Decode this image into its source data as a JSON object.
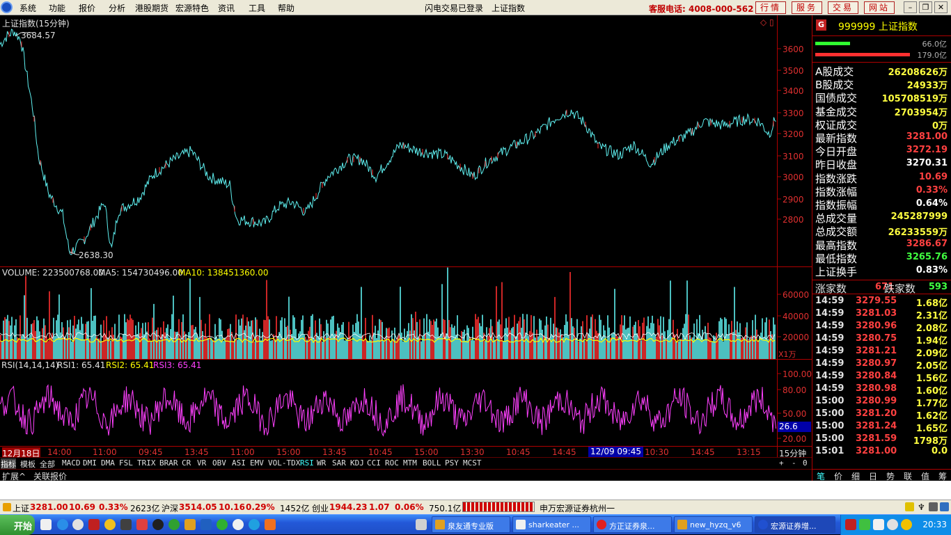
{
  "menu": {
    "items": [
      "系统",
      "功能",
      "报价",
      "分析",
      "港股期货",
      "宏源特色",
      "资讯",
      "工具",
      "帮助"
    ],
    "status_center": "闪电交易已登录",
    "center_title": "上证指数",
    "hotline": "客服电话: 4008-000-562",
    "tabs": [
      "行情",
      "服务",
      "交易",
      "网站"
    ]
  },
  "chart": {
    "title": "上证指数(15分钟)",
    "high_label": "3684.57",
    "low_label": "2638.30",
    "price_ticks": [
      "3600",
      "3500",
      "3400",
      "3300",
      "3200",
      "3100",
      "3000",
      "2900",
      "2800"
    ],
    "volume_header": {
      "vol": "VOLUME: 223500768.00",
      "ma5": "MA5: 154730496.00",
      "ma10": "MA10: 138451360.00"
    },
    "volume_ticks": [
      "60000",
      "40000",
      "20000"
    ],
    "volume_unit": "X1万",
    "rsi_header": {
      "name": "RSI(14,14,14)",
      "rsi1": "RSI1: 65.41",
      "rsi2": "RSI2: 65.41",
      "rsi3": "RSI3: 65.41"
    },
    "rsi_ticks": [
      "100.00",
      "80.00",
      "50.00",
      "20.00"
    ],
    "rsi_current": "26.6",
    "x_labels": [
      "12月18日",
      "14:00",
      "11:00",
      "09:45",
      "13:45",
      "11:00",
      "15:00",
      "13:45",
      "10:45",
      "15:00",
      "13:30",
      "10:45",
      "14:45",
      "12/09 09:45",
      "10:30",
      "14:45",
      "13:15"
    ],
    "period": "15分钟"
  },
  "indicators": [
    "指标",
    "模板",
    "全部",
    "MACD",
    "DMI",
    "DMA",
    "FSL",
    "TRIX",
    "BRAR",
    "CR",
    "VR",
    "OBV",
    "ASI",
    "EMV",
    "VOL-TDX",
    "RSI",
    "WR",
    "SAR",
    "KDJ",
    "CCI",
    "ROC",
    "MTM",
    "BOLL",
    "PSY",
    "MCST"
  ],
  "indicator_active": "RSI",
  "indicator_controls": [
    "+",
    "-",
    "0"
  ],
  "extension_tabs": [
    "扩展^",
    "关联报价"
  ],
  "side": {
    "badge": "G",
    "code_name": "999999 上证指数",
    "bar1_value": "66.0亿",
    "bar2_value": "179.0亿",
    "stats": [
      {
        "k": "A股成交",
        "v": "26208626万",
        "c": "#ffff40"
      },
      {
        "k": "B股成交",
        "v": "24933万",
        "c": "#ffff40"
      },
      {
        "k": "国债成交",
        "v": "105708519万",
        "c": "#ffff40"
      },
      {
        "k": "基金成交",
        "v": "2703954万",
        "c": "#ffff40"
      },
      {
        "k": "权证成交",
        "v": "0万",
        "c": "#ffff40"
      },
      {
        "k": "最新指数",
        "v": "3281.00",
        "c": "#ff4040"
      },
      {
        "k": "今日开盘",
        "v": "3272.19",
        "c": "#ff4040"
      },
      {
        "k": "昨日收盘",
        "v": "3270.31",
        "c": "#ffffff"
      },
      {
        "k": "指数涨跌",
        "v": "10.69",
        "c": "#ff4040"
      },
      {
        "k": "指数涨幅",
        "v": "0.33%",
        "c": "#ff4040"
      },
      {
        "k": "指数振幅",
        "v": "0.64%",
        "c": "#ffffff"
      },
      {
        "k": "总成交量",
        "v": "245287999",
        "c": "#ffff40"
      },
      {
        "k": "总成交额",
        "v": "26233559万",
        "c": "#ffff40"
      },
      {
        "k": "最高指数",
        "v": "3286.67",
        "c": "#ff4040"
      },
      {
        "k": "最低指数",
        "v": "3265.76",
        "c": "#40ff40"
      },
      {
        "k": "上证换手",
        "v": "0.83%",
        "c": "#ffffff"
      }
    ],
    "rise_label": "涨家数",
    "rise_count": "671",
    "fall_label": "跌家数",
    "fall_count": "593",
    "ticks": [
      {
        "t": "14:59",
        "p": "3279.55",
        "q": "1.68亿"
      },
      {
        "t": "14:59",
        "p": "3281.03",
        "q": "2.31亿"
      },
      {
        "t": "14:59",
        "p": "3280.96",
        "q": "2.08亿"
      },
      {
        "t": "14:59",
        "p": "3280.75",
        "q": "1.94亿"
      },
      {
        "t": "14:59",
        "p": "3281.21",
        "q": "2.09亿"
      },
      {
        "t": "14:59",
        "p": "3280.97",
        "q": "2.05亿"
      },
      {
        "t": "14:59",
        "p": "3280.84",
        "q": "1.56亿"
      },
      {
        "t": "14:59",
        "p": "3280.98",
        "q": "1.60亿"
      },
      {
        "t": "15:00",
        "p": "3280.99",
        "q": "1.77亿"
      },
      {
        "t": "15:00",
        "p": "3281.20",
        "q": "1.62亿"
      },
      {
        "t": "15:00",
        "p": "3281.24",
        "q": "1.65亿"
      },
      {
        "t": "15:00",
        "p": "3281.59",
        "q": "1798万"
      },
      {
        "t": "15:01",
        "p": "3281.00",
        "q": "0.0"
      }
    ],
    "bottom_tabs": [
      "笔",
      "价",
      "细",
      "日",
      "势",
      "联",
      "值",
      "筹"
    ]
  },
  "status_bar": {
    "sh_name": "上证",
    "sh_price": "3281.00",
    "sh_chg": "10.69",
    "sh_pct": "0.33%",
    "sh_amt": "2623亿",
    "hs_name": "沪深",
    "hs_price": "3514.05",
    "hs_chg": "10.16",
    "hs_pct": "0.29%",
    "hs_amt": "1452亿",
    "cy_name": "创业",
    "cy_price": "1944.23",
    "cy_chg": "1.07",
    "cy_pct": "0.06%",
    "cy_amt": "750.1亿",
    "broker": "申万宏源证券杭州一"
  },
  "taskbar": {
    "start": "开始",
    "tasks": [
      "泉友通专业版",
      "sharkeater ...",
      "方正证券泉...",
      "new_hyzq_v6",
      "宏源证券增..."
    ],
    "clock": "20:33"
  },
  "colors": {
    "up": "#ff4040",
    "down": "#40ff40",
    "grid": "#b00000",
    "price_line": "#5ff0f0",
    "rsi": "#ff40ff",
    "ma5": "#ffffff",
    "ma10": "#ffff00"
  }
}
